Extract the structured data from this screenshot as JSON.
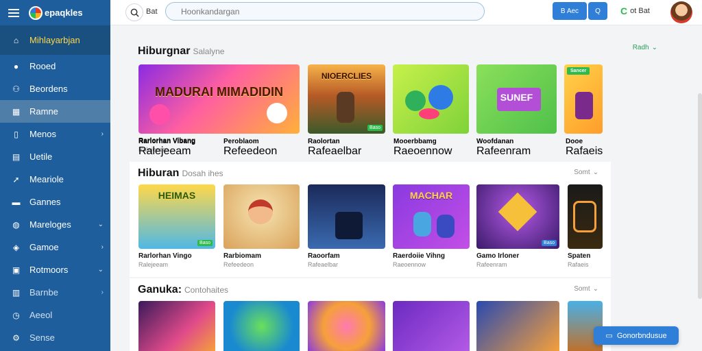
{
  "app": {
    "logo_text": "epaqkles"
  },
  "sidebar": {
    "items": [
      {
        "label": "Mihlayarbjan",
        "icon": "home-icon"
      },
      {
        "label": "Rooed",
        "icon": "person-icon"
      },
      {
        "label": "Beordens",
        "icon": "people-icon"
      },
      {
        "label": "Ramne",
        "icon": "grid-icon"
      },
      {
        "label": "Menos",
        "icon": "book-icon"
      },
      {
        "label": "Uetile",
        "icon": "doc-icon"
      },
      {
        "label": "Meariole",
        "icon": "rocket-icon"
      },
      {
        "label": "Gannes",
        "icon": "gamepad-icon"
      },
      {
        "label": "Mareloges",
        "icon": "chat-icon"
      },
      {
        "label": "Gamoe",
        "icon": "shield-icon"
      },
      {
        "label": "Rotmoors",
        "icon": "calendar-icon"
      },
      {
        "label": "Barnbe",
        "icon": "box-icon"
      },
      {
        "label": "Aeeol",
        "icon": "clock-icon"
      },
      {
        "label": "Sense",
        "icon": "gear-icon"
      }
    ]
  },
  "topbar": {
    "label": "Bat",
    "search_placeholder": "Hoonkandargan",
    "btn_a": "B Aec",
    "btn_b": "Q",
    "user": "ot Bat"
  },
  "sections": [
    {
      "title": "Hiburgnar",
      "subtitle": "Salalyne",
      "more": "Radh",
      "cards": [
        {
          "name": "Rarlorhan Vibang",
          "meta": "Ralejeeam",
          "art": "MADURAI MIMADIDIN"
        },
        {
          "name": "Peroblaom",
          "meta": "Refeedeon",
          "art": ""
        },
        {
          "name": "Raolortan",
          "meta": "Rafeaelbar",
          "art": "NIOERCLIES"
        },
        {
          "name": "Mooerbbamg",
          "meta": "Raeoennow",
          "art": ""
        },
        {
          "name": "Woofdanan",
          "meta": "Rafeenram",
          "art": "SUNEF"
        },
        {
          "name": "Dooe",
          "meta": "Rafaeis",
          "art": ""
        }
      ]
    },
    {
      "title": "Hiburan",
      "subtitle": "Dosah ihes",
      "more": "Somt",
      "cards": [
        {
          "name": "Rarlorhan Vingo",
          "meta": "Ralejeeam",
          "art": "HEIMAS"
        },
        {
          "name": "Rarbiomam",
          "meta": "Refeedeon",
          "art": ""
        },
        {
          "name": "Raoorfam",
          "meta": "Rafeaelbar",
          "art": ""
        },
        {
          "name": "Raerdoiie Vihng",
          "meta": "Raeoennow",
          "art": "MACHAR"
        },
        {
          "name": "Gamo Irloner",
          "meta": "Rafeenram",
          "art": ""
        },
        {
          "name": "Spaten",
          "meta": "Rafaeis",
          "art": ""
        }
      ]
    },
    {
      "title": "Ganuka:",
      "subtitle": "Contohaites",
      "more": "Somt",
      "cards": [
        {
          "name": "",
          "meta": ""
        },
        {
          "name": "",
          "meta": ""
        },
        {
          "name": "",
          "meta": ""
        },
        {
          "name": "",
          "meta": ""
        },
        {
          "name": "",
          "meta": ""
        },
        {
          "name": "",
          "meta": ""
        }
      ]
    }
  ],
  "cta_label": "Gonorbndusue",
  "badges": {
    "new_label": "Sancer",
    "tag": "Baso"
  }
}
